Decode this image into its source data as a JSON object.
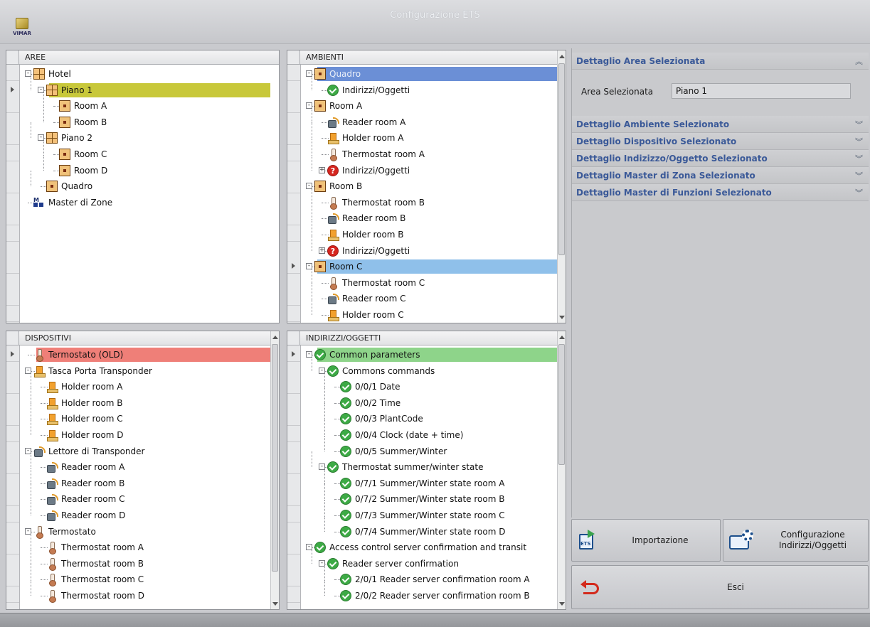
{
  "window": {
    "title": "Configurazione ETS",
    "logo_text": "VIMAR"
  },
  "aree": {
    "header": "AREE",
    "rows": [
      {
        "label": "Hotel",
        "icon": "area-icon",
        "level": 0,
        "expander": "-"
      },
      {
        "label": "Piano 1",
        "icon": "area-icon",
        "level": 1,
        "expander": "-",
        "selected": true
      },
      {
        "label": "Room A",
        "icon": "room-icon",
        "level": 2
      },
      {
        "label": "Room B",
        "icon": "room-icon",
        "level": 2
      },
      {
        "label": "Piano 2",
        "icon": "area-icon",
        "level": 1,
        "expander": "-"
      },
      {
        "label": "Room C",
        "icon": "room-icon",
        "level": 2
      },
      {
        "label": "Room D",
        "icon": "room-icon",
        "level": 2
      },
      {
        "label": "Quadro",
        "icon": "room-icon",
        "level": 1
      },
      {
        "label": "Master di Zone",
        "icon": "master-icon",
        "level": 0
      }
    ]
  },
  "ambienti": {
    "header": "AMBIENTI",
    "rows": [
      {
        "label": "Quadro",
        "icon": "room-icon",
        "level": 0,
        "expander": "-",
        "selected": "blue-dark"
      },
      {
        "label": "Indirizzi/Oggetti",
        "icon": "check-icon",
        "level": 1
      },
      {
        "label": "Room A",
        "icon": "room-icon",
        "level": 0,
        "expander": "-"
      },
      {
        "label": "Reader room A",
        "icon": "reader-icon",
        "level": 1
      },
      {
        "label": "Holder room A",
        "icon": "holder-icon",
        "level": 1
      },
      {
        "label": "Thermostat room A",
        "icon": "thermostat-icon",
        "level": 1
      },
      {
        "label": "Indirizzi/Oggetti",
        "icon": "question-icon",
        "level": 1,
        "expander": "+"
      },
      {
        "label": "Room B",
        "icon": "room-icon",
        "level": 0,
        "expander": "-"
      },
      {
        "label": "Thermostat room B",
        "icon": "thermostat-icon",
        "level": 1
      },
      {
        "label": "Reader room B",
        "icon": "reader-icon",
        "level": 1
      },
      {
        "label": "Holder room B",
        "icon": "holder-icon",
        "level": 1
      },
      {
        "label": "Indirizzi/Oggetti",
        "icon": "question-icon",
        "level": 1,
        "expander": "+"
      },
      {
        "label": "Room C",
        "icon": "room-icon",
        "level": 0,
        "expander": "-",
        "selected": "blue"
      },
      {
        "label": "Thermostat room C",
        "icon": "thermostat-icon",
        "level": 1
      },
      {
        "label": "Reader room C",
        "icon": "reader-icon",
        "level": 1
      },
      {
        "label": "Holder room C",
        "icon": "holder-icon",
        "level": 1
      }
    ]
  },
  "dispositivi": {
    "header": "DISPOSITIVI",
    "rows": [
      {
        "label": "Termostato (OLD)",
        "icon": "thermostat-icon",
        "level": 0,
        "selected": "red"
      },
      {
        "label": "Tasca Porta Transponder",
        "icon": "holder-icon",
        "level": 0,
        "expander": "-"
      },
      {
        "label": "Holder room A",
        "icon": "holder-icon",
        "level": 1
      },
      {
        "label": "Holder room B",
        "icon": "holder-icon",
        "level": 1
      },
      {
        "label": "Holder room C",
        "icon": "holder-icon",
        "level": 1
      },
      {
        "label": "Holder room D",
        "icon": "holder-icon",
        "level": 1
      },
      {
        "label": "Lettore di Transponder",
        "icon": "reader-icon",
        "level": 0,
        "expander": "-"
      },
      {
        "label": "Reader room A",
        "icon": "reader-icon",
        "level": 1
      },
      {
        "label": "Reader room B",
        "icon": "reader-icon",
        "level": 1
      },
      {
        "label": "Reader room C",
        "icon": "reader-icon",
        "level": 1
      },
      {
        "label": "Reader room D",
        "icon": "reader-icon",
        "level": 1
      },
      {
        "label": "Termostato",
        "icon": "thermostat-icon",
        "level": 0,
        "expander": "-"
      },
      {
        "label": "Thermostat room A",
        "icon": "thermostat-icon",
        "level": 1
      },
      {
        "label": "Thermostat room B",
        "icon": "thermostat-icon",
        "level": 1
      },
      {
        "label": "Thermostat room C",
        "icon": "thermostat-icon",
        "level": 1
      },
      {
        "label": "Thermostat room D",
        "icon": "thermostat-icon",
        "level": 1
      }
    ]
  },
  "indirizzi": {
    "header": "INDIRIZZI/OGGETTI",
    "rows": [
      {
        "label": "Common parameters",
        "icon": "check-icon",
        "level": 0,
        "expander": "-",
        "selected": "green"
      },
      {
        "label": "Commons commands",
        "icon": "check-icon",
        "level": 1,
        "expander": "-"
      },
      {
        "label": "0/0/1 Date",
        "icon": "check-icon",
        "level": 2
      },
      {
        "label": "0/0/2 Time",
        "icon": "check-icon",
        "level": 2
      },
      {
        "label": "0/0/3 PlantCode",
        "icon": "check-icon",
        "level": 2
      },
      {
        "label": "0/0/4 Clock (date + time)",
        "icon": "check-icon",
        "level": 2
      },
      {
        "label": "0/0/5 Summer/Winter",
        "icon": "check-icon",
        "level": 2
      },
      {
        "label": "Thermostat summer/winter state",
        "icon": "check-icon",
        "level": 1,
        "expander": "-"
      },
      {
        "label": "0/7/1 Summer/Winter state room A",
        "icon": "check-icon",
        "level": 2
      },
      {
        "label": "0/7/2 Summer/Winter state room B",
        "icon": "check-icon",
        "level": 2
      },
      {
        "label": "0/7/3 Summer/Winter state room C",
        "icon": "check-icon",
        "level": 2
      },
      {
        "label": "0/7/4 Summer/Winter state room D",
        "icon": "check-icon",
        "level": 2
      },
      {
        "label": "Access control server confirmation and transit",
        "icon": "check-icon",
        "level": 0,
        "expander": "-"
      },
      {
        "label": "Reader server confirmation",
        "icon": "check-icon",
        "level": 1,
        "expander": "-"
      },
      {
        "label": "2/0/1 Reader server confirmation room A",
        "icon": "check-icon",
        "level": 2
      },
      {
        "label": "2/0/2 Reader server confirmation room B",
        "icon": "check-icon",
        "level": 2
      }
    ]
  },
  "details": {
    "sections": [
      {
        "title": "Dettaglio Area Selezionata",
        "expanded": true
      },
      {
        "title": "Dettaglio Ambiente Selezionato",
        "expanded": false
      },
      {
        "title": "Dettaglio Dispositivo Selezionato",
        "expanded": false
      },
      {
        "title": "Dettaglio Indizizzo/Oggetto Selezionato",
        "expanded": false
      },
      {
        "title": "Dettaglio Master di Zona Selezionato",
        "expanded": false
      },
      {
        "title": "Dettaglio Master di Funzioni Selezionato",
        "expanded": false
      }
    ],
    "area_label": "Area Selezionata",
    "area_value": "Piano 1",
    "chevron_up": "︽",
    "chevron_down": "︾"
  },
  "actions": {
    "import_label": "Importazione",
    "config_label_line1": "Configurazione",
    "config_label_line2": "Indirizzi/Oggetti",
    "exit_label": "Esci",
    "ets_tag": "ETS"
  },
  "colors": {
    "sel_yellow": "#c8c83a",
    "sel_blue_dark": "#6b8fd6",
    "sel_blue": "#8fc0ea",
    "sel_red": "#ef7f78",
    "sel_green": "#8ed48a",
    "accent": "#3a5998"
  }
}
